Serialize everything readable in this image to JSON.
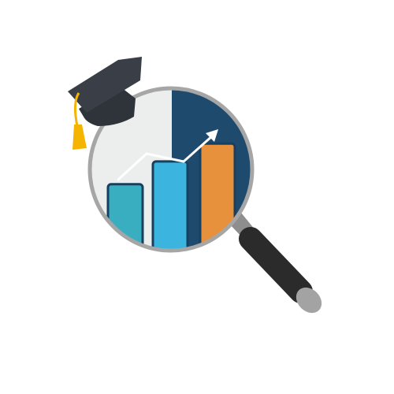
{
  "illustration": {
    "icons": {
      "main": "magnifying-glass-icon",
      "hat": "graduation-cap-icon",
      "chart": "bar-chart-icon",
      "trend": "trend-arrow-icon"
    },
    "colors": {
      "lens_rim": "#a6a6a6",
      "lens_left_bg": "#eceded",
      "lens_right_bg": "#1e4a6e",
      "bar_teal": "#3aaec1",
      "bar_sky": "#3bb5df",
      "bar_orange": "#e7913d",
      "bar_edge": "#173f5f",
      "trend_line": "#ffffff",
      "handle": "#2b2b2b",
      "handle_neck": "#8e8e8e",
      "handle_cap": "#a3a3a3",
      "cap_board": "#3a3f47",
      "cap_base": "#2f343b",
      "tassel": "#f4b400"
    },
    "bars": [
      {
        "name": "bar-1",
        "level": 0.38
      },
      {
        "name": "bar-2",
        "level": 0.52
      },
      {
        "name": "bar-3",
        "level": 0.63
      }
    ]
  }
}
